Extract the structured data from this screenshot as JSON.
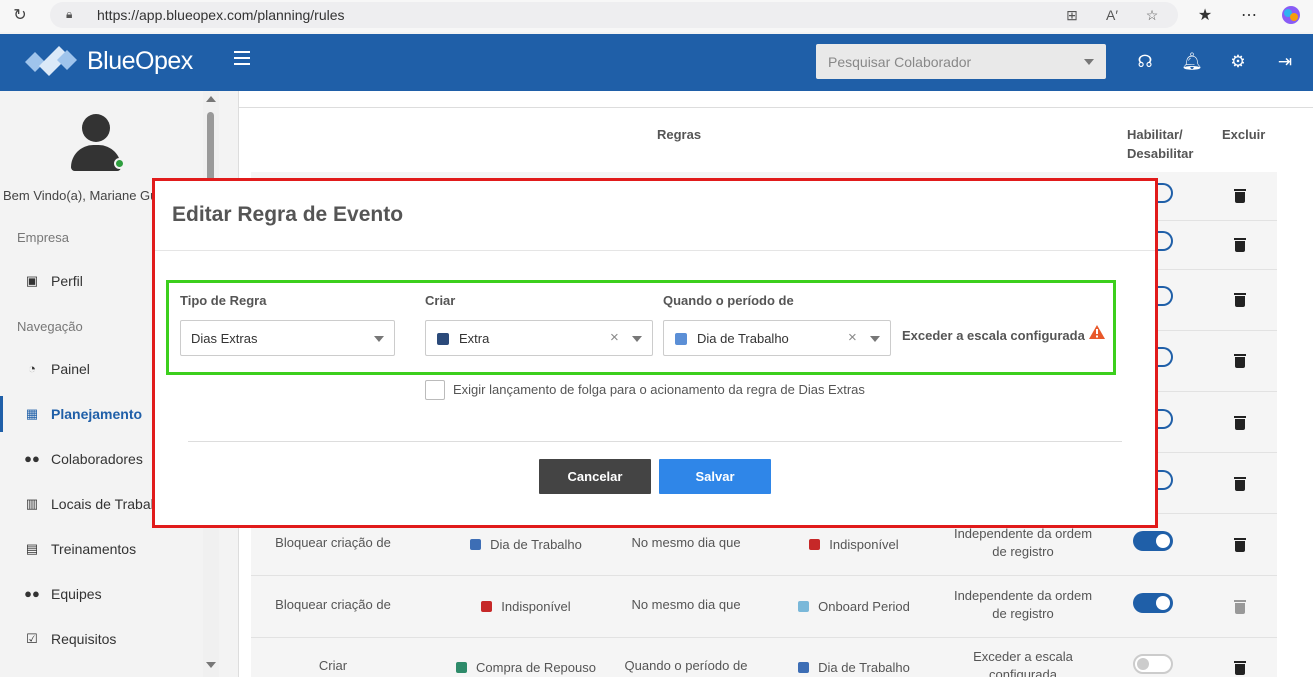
{
  "browser": {
    "url": "https://app.blueopex.com/planning/rules"
  },
  "header": {
    "logo_text": "BlueOpex",
    "search_placeholder": "Pesquisar Colaborador"
  },
  "sidebar": {
    "welcome": "Bem Vindo(a), Mariane Gu",
    "section_empresa": "Empresa",
    "section_navegacao": "Navegação",
    "items": [
      {
        "label": "Perfil"
      },
      {
        "label": "Painel"
      },
      {
        "label": "Planejamento"
      },
      {
        "label": "Colaboradores"
      },
      {
        "label": "Locais de Trabal"
      },
      {
        "label": "Treinamentos"
      },
      {
        "label": "Equipes"
      },
      {
        "label": "Requisitos"
      }
    ]
  },
  "table": {
    "col_regras": "Regras",
    "col_habilitar_1": "Habilitar/",
    "col_habilitar_2": "Desabilitar",
    "col_excluir": "Excluir",
    "rows": [
      {
        "action": "Bloquear criação de",
        "event": "Dia de Trabalho",
        "event_color": "#3d6eb5",
        "cond": "No mesmo dia que",
        "target": "Indisponível",
        "target_color": "#c62828",
        "order_1": "Independente da ordem",
        "order_2": "de registro",
        "enabled": true
      },
      {
        "action": "Bloquear criação de",
        "event": "Indisponível",
        "event_color": "#c62828",
        "cond": "No mesmo dia que",
        "target": "Onboard Period",
        "target_color": "#7ab8d9",
        "order_1": "Independente da ordem",
        "order_2": "de registro",
        "enabled": true
      },
      {
        "action": "Criar",
        "event": "Compra de Repouso",
        "event_color": "#2e8b6a",
        "cond": "Quando o período de",
        "target": "Dia de Trabalho",
        "target_color": "#3d6eb5",
        "order_1": "Exceder a escala",
        "order_2": "configurada",
        "enabled": false
      }
    ]
  },
  "modal": {
    "title": "Editar Regra de Evento",
    "tipo_label": "Tipo de Regra",
    "tipo_value": "Dias Extras",
    "criar_label": "Criar",
    "criar_value": "Extra",
    "criar_color": "#2b4a7a",
    "quando_label": "Quando o período de",
    "quando_value": "Dia de Trabalho",
    "quando_color": "#5b8fd6",
    "exceed_text": "Exceder a escala configurada",
    "checkbox_label": "Exigir lançamento de folga para o acionamento da regra de Dias Extras",
    "cancel_label": "Cancelar",
    "save_label": "Salvar"
  }
}
